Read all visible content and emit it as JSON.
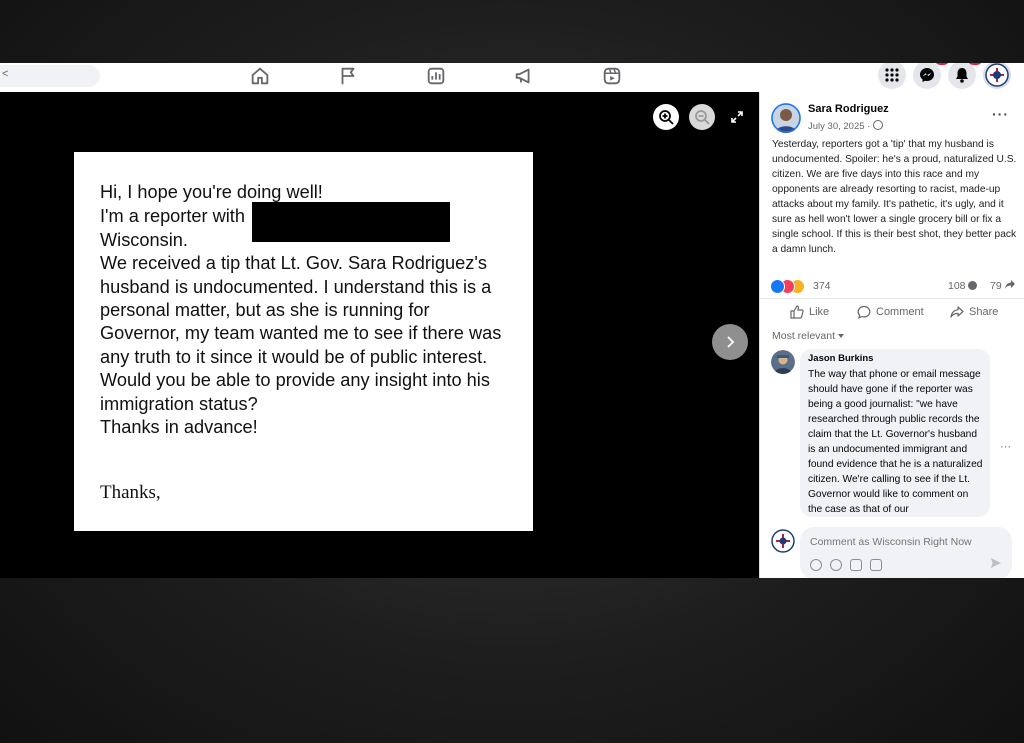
{
  "nav": {
    "search_stub_char": "<",
    "icons": [
      "home-icon",
      "flag-icon",
      "analytics-icon",
      "megaphone-icon",
      "reels-icon"
    ],
    "right_icons": [
      "menu-grid-icon",
      "messenger-icon",
      "bell-icon",
      "profile-avatar"
    ]
  },
  "note": {
    "lines": [
      "Hi, I hope you're doing well!",
      "I'm a reporter with",
      "Wisconsin.",
      "We received a tip that Lt. Gov. Sara Rodriguez's",
      "husband is undocumented. I understand this is a",
      "personal matter, but as she is running for",
      "Governor, my team wanted me to see if there was",
      "any truth to it since it would be of public interest.",
      "Would you be able to provide any insight into his",
      "immigration status?",
      "Thanks in advance!"
    ],
    "signoff": "Thanks,"
  },
  "post": {
    "author": "Sara Rodriguez",
    "date": "July 30, 2025 · ",
    "more": "···",
    "text": "Yesterday, reporters got a 'tip' that my husband is undocumented. Spoiler: he's a proud, naturalized U.S. citizen. We are five days into this race and my opponents are already resorting to racist, made-up attacks about my family. It's pathetic, it's ugly, and it sure as hell won't lower a single grocery bill or fix a single school. If this is their best shot, they better pack a damn lunch.",
    "reaction_count": "374",
    "comment_count": "108",
    "share_count": "79",
    "like_label": "Like",
    "comment_label": "Comment",
    "share_label": "Share",
    "sort_label": "Most relevant"
  },
  "comment": {
    "author": "Jason Burkins",
    "text": "The way that phone or email message should have gone if the reporter was being a good journalist: \"we have researched through public records the claim that the Lt. Governor's husband is an undocumented immigrant and found evidence that he is a naturalized citizen. We're calling to see if the Lt. Governor would like to comment on the case as that of our",
    "more": "···"
  },
  "composer": {
    "placeholder": "Comment as Wisconsin Right Now"
  },
  "colors": {
    "brand_blue": "#1877f2",
    "like_blue": "#1877f2",
    "love_red": "#f33e58",
    "care_yellow": "#f7b125"
  }
}
